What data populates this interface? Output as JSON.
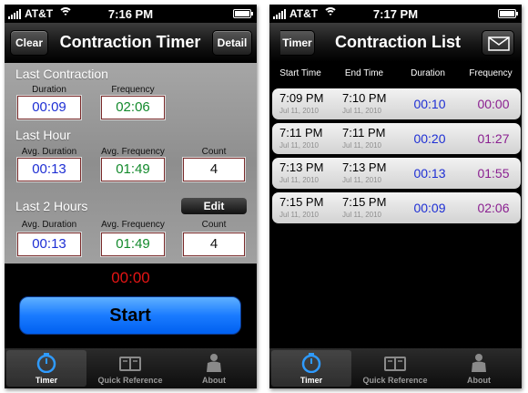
{
  "timer_screen": {
    "status": {
      "carrier": "AT&T",
      "time": "7:16 PM"
    },
    "nav": {
      "left_button": "Clear",
      "title": "Contraction Timer",
      "right_button": "Detail"
    },
    "last_contraction": {
      "title": "Last Contraction",
      "duration_label": "Duration",
      "duration": "00:09",
      "frequency_label": "Frequency",
      "frequency": "02:06"
    },
    "last_hour": {
      "title": "Last Hour",
      "avg_duration_label": "Avg. Duration",
      "avg_duration": "00:13",
      "avg_frequency_label": "Avg. Frequency",
      "avg_frequency": "01:49",
      "count_label": "Count",
      "count": "4"
    },
    "last_2_hours": {
      "title": "Last 2 Hours",
      "edit_label": "Edit",
      "avg_duration_label": "Avg. Duration",
      "avg_duration": "00:13",
      "avg_frequency_label": "Avg. Frequency",
      "avg_frequency": "01:49",
      "count_label": "Count",
      "count": "4"
    },
    "timer_display": "00:00",
    "start_label": "Start"
  },
  "list_screen": {
    "status": {
      "carrier": "AT&T",
      "time": "7:17 PM"
    },
    "nav": {
      "back_button": "Timer",
      "title": "Contraction List"
    },
    "columns": [
      "Start Time",
      "End Time",
      "Duration",
      "Frequency"
    ],
    "rows": [
      {
        "start": "7:09 PM",
        "start_date": "Jul 11, 2010",
        "end": "7:10 PM",
        "end_date": "Jul 11, 2010",
        "duration": "00:10",
        "frequency": "00:00"
      },
      {
        "start": "7:11 PM",
        "start_date": "Jul 11, 2010",
        "end": "7:11 PM",
        "end_date": "Jul 11, 2010",
        "duration": "00:20",
        "frequency": "01:27"
      },
      {
        "start": "7:13 PM",
        "start_date": "Jul 11, 2010",
        "end": "7:13 PM",
        "end_date": "Jul 11, 2010",
        "duration": "00:13",
        "frequency": "01:55"
      },
      {
        "start": "7:15 PM",
        "start_date": "Jul 11, 2010",
        "end": "7:15 PM",
        "end_date": "Jul 11, 2010",
        "duration": "00:09",
        "frequency": "02:06"
      }
    ]
  },
  "tabs": [
    {
      "label": "Timer",
      "icon": "stopwatch-icon",
      "active": true
    },
    {
      "label": "Quick Reference",
      "icon": "book-icon",
      "active": false
    },
    {
      "label": "About",
      "icon": "person-icon",
      "active": false
    }
  ],
  "colors": {
    "accent_blue": "#1a7bff",
    "timer_red": "#e31414",
    "duration_blue": "#1e2fd4",
    "frequency_green": "#138a2c",
    "frequency_purple": "#8a1f90"
  }
}
